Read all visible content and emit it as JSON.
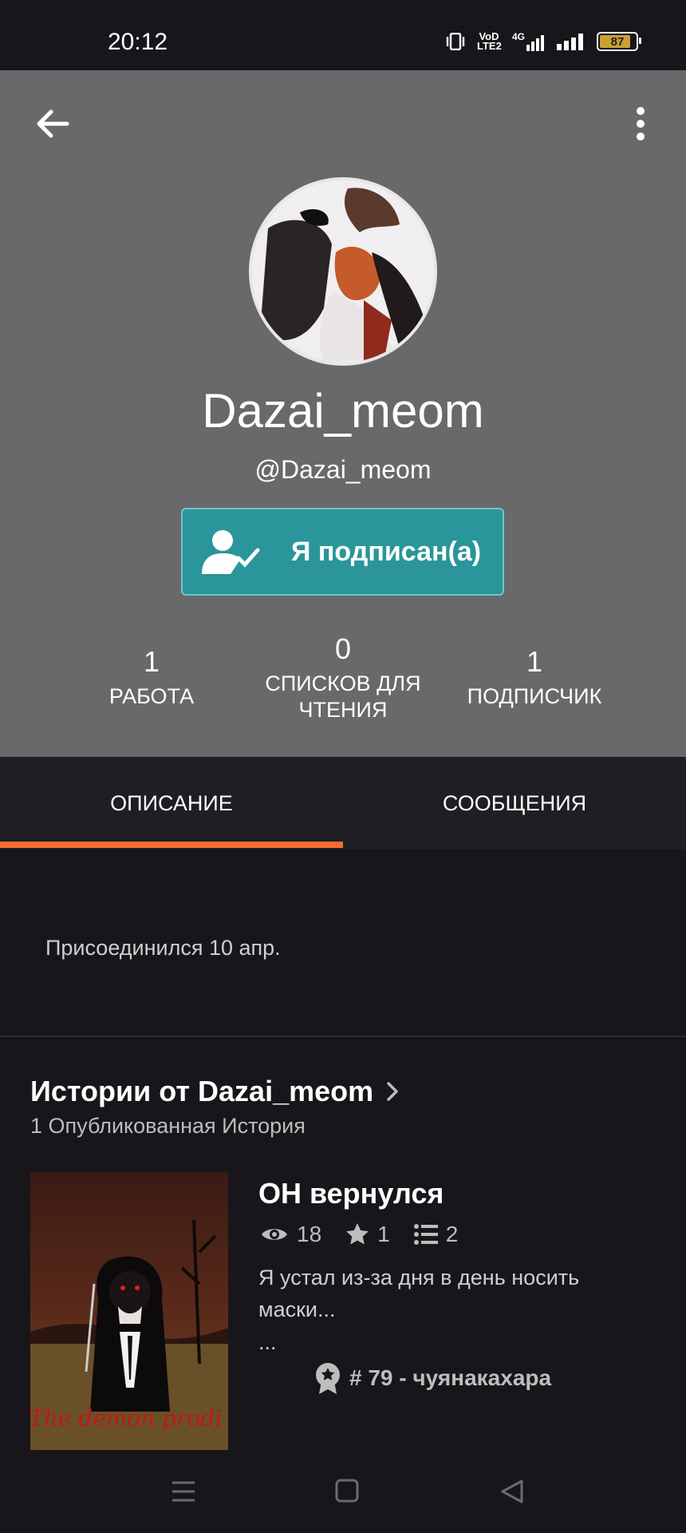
{
  "status_bar": {
    "time": "20:12",
    "indicators": [
      "vibrate-icon",
      "volte-icon",
      "4g-signal-icon",
      "signal-icon"
    ],
    "volte_text": "VoD LTE2",
    "network": "4G",
    "battery": "87"
  },
  "profile": {
    "name": "Dazai_meom",
    "handle": "@Dazai_meom",
    "follow_label": "Я подписан(а)",
    "stats": {
      "works_count": "1",
      "works_label": "РАБОТА",
      "lists_count": "0",
      "lists_label": "СПИСКОВ ДЛЯ ЧТЕНИЯ",
      "followers_count": "1",
      "followers_label": "ПОДПИСЧИК"
    }
  },
  "tabs": [
    {
      "label": "ОПИСАНИЕ",
      "active": true
    },
    {
      "label": "СООБЩЕНИЯ",
      "active": false
    }
  ],
  "about": {
    "joined": "Присоединился 10 апр."
  },
  "stories": {
    "title": "Истории от Dazai_meom",
    "subtitle": "1 Опубликованная История",
    "items": [
      {
        "title": "ОН вернулся",
        "reads": "18",
        "votes": "1",
        "parts": "2",
        "description": "Я устал из-за дня в день носить маски...",
        "more": "...",
        "rank": "# 79 - чуянакахара",
        "cover_text": "The demon prodi"
      }
    ]
  },
  "colors": {
    "header_bg": "#69686a",
    "accent_teal": "#2a959a",
    "tab_indicator": "#ff6a32",
    "page_bg": "#18161a"
  }
}
